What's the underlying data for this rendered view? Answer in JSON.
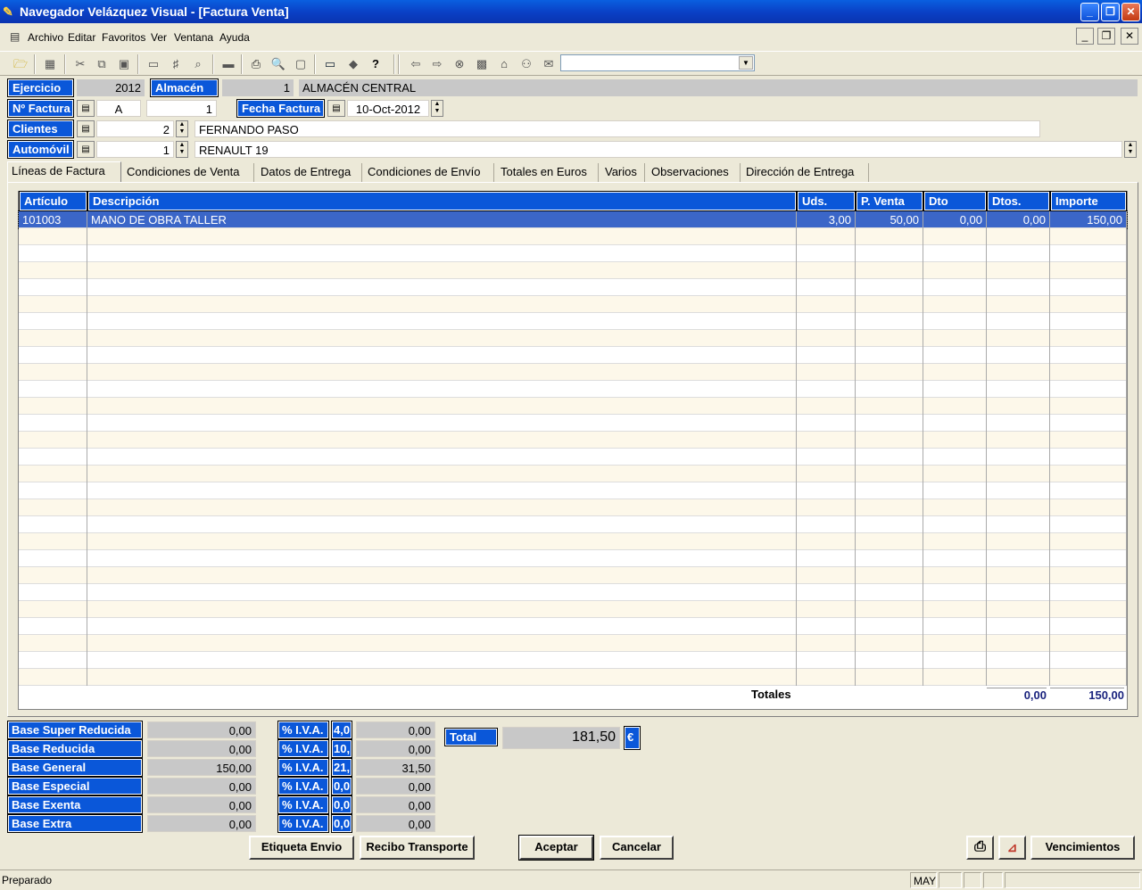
{
  "window": {
    "title": "Navegador Velázquez Visual - [Factura Venta]"
  },
  "menu": [
    "Archivo",
    "Editar",
    "Favoritos",
    "Ver",
    "Ventana",
    "Ayuda"
  ],
  "header": {
    "ejercicio_label": "Ejercicio",
    "ejercicio": "2012",
    "almacen_label": "Almacén",
    "almacen_code": "1",
    "almacen_name": "ALMACÉN CENTRAL",
    "factura_label": "Nº Factura",
    "serie": "A",
    "numero": "1",
    "fecha_label": "Fecha Factura",
    "fecha": "10-Oct-2012",
    "clientes_label": "Clientes",
    "cliente_code": "2",
    "cliente_name": "FERNANDO PASO",
    "automovil_label": "Automóvil",
    "automovil_code": "1",
    "automovil_name": "RENAULT 19"
  },
  "tabs": [
    "Líneas de Factura",
    "Condiciones de Venta",
    "Datos de Entrega",
    "Condiciones de Envío",
    "Totales en Euros",
    "Varios",
    "Observaciones",
    "Dirección de Entrega"
  ],
  "grid": {
    "columns": [
      "Artículo",
      "Descripción",
      "Uds.",
      "P. Venta",
      "Dto",
      "Dtos.",
      "Importe"
    ],
    "rows": [
      [
        "101003",
        "MANO DE OBRA TALLER",
        "3,00",
        "50,00",
        "0,00",
        "0,00",
        "150,00"
      ]
    ],
    "totals_label": "Totales",
    "total_dtos": "0,00",
    "total_importe": "150,00"
  },
  "bases": [
    {
      "label": "Base Super Reducida",
      "value": "0,00",
      "iva_label": "% I.V.A.",
      "iva_pct": "4,0",
      "cuota": "0,00"
    },
    {
      "label": "Base Reducida",
      "value": "0,00",
      "iva_label": "% I.V.A.",
      "iva_pct": "10,",
      "cuota": "0,00"
    },
    {
      "label": "Base General",
      "value": "150,00",
      "iva_label": "% I.V.A.",
      "iva_pct": "21,",
      "cuota": "31,50"
    },
    {
      "label": "Base Especial",
      "value": "0,00",
      "iva_label": "% I.V.A.",
      "iva_pct": "0,0",
      "cuota": "0,00"
    },
    {
      "label": "Base Exenta",
      "value": "0,00",
      "iva_label": "% I.V.A.",
      "iva_pct": "0,0",
      "cuota": "0,00"
    },
    {
      "label": "Base Extra",
      "value": "0,00",
      "iva_label": "% I.V.A.",
      "iva_pct": "0,0",
      "cuota": "0,00"
    }
  ],
  "total": {
    "label": "Total",
    "value": "181,50",
    "currency": "€"
  },
  "buttons": {
    "etiqueta": "Etiqueta Envio",
    "recibo": "Recibo Transporte",
    "aceptar": "Aceptar",
    "cancelar": "Cancelar",
    "vencimientos": "Vencimientos"
  },
  "status": {
    "text": "Preparado",
    "caps": "MAY"
  }
}
